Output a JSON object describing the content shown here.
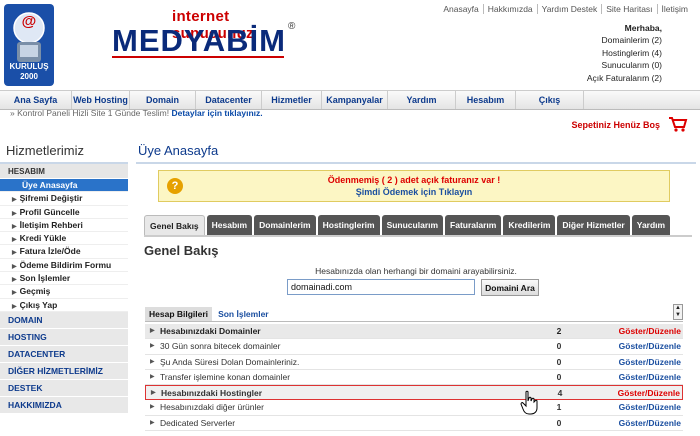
{
  "header": {
    "badge": {
      "label": "KURULUŞ",
      "year": "2000"
    },
    "brand": {
      "tagline": "internet sunucunuz",
      "name": "MEDYABİM",
      "registered": "®"
    },
    "top_links": [
      "Anasayfa",
      "Hakkımızda",
      "Yardım Destek",
      "Site Haritası",
      "İletişim"
    ],
    "welcome": {
      "greeting": "Merhaba,",
      "lines": [
        "Domainlerim (2)",
        "Hostinglerim (4)",
        "Sunucularım (0)",
        "Açık Faturalarım (2)"
      ]
    }
  },
  "nav": [
    "Ana Sayfa",
    "Web Hosting",
    "Domain",
    "Datacenter",
    "Hizmetler",
    "Kampanyalar",
    "Yardım",
    "Hesabım",
    "Çıkış"
  ],
  "ticker": {
    "text": "Kontrol Paneli Hizli Site 1 Günde Teslim!",
    "link": "Detaylar için tıklayınız."
  },
  "cart": {
    "label": "Sepetiniz Henüz Boş"
  },
  "sidebar": {
    "title": "Hizmetlerimiz",
    "section": "HESABIM",
    "items": [
      "Üye Anasayfa",
      "Şifremi Değiştir",
      "Profil Güncelle",
      "İletişim Rehberi",
      "Kredi Yükle",
      "Fatura İzle/Öde",
      "Ödeme Bildirim Formu",
      "Son İşlemler",
      "Geçmiş",
      "Çıkış Yap"
    ],
    "categories": [
      "DOMAIN",
      "HOSTING",
      "DATACENTER",
      "DİĞER HİZMETLERİMİZ",
      "DESTEK",
      "HAKKIMIZDA"
    ]
  },
  "main": {
    "title": "Üye Anasayfa",
    "alert": {
      "line1": "Ödenmemiş ( 2 ) adet açık faturanız var !",
      "line2": "Şimdi Ödemek için Tıklayın"
    },
    "tabs": [
      "Genel Bakış",
      "Hesabım",
      "Domainlerim",
      "Hostinglerim",
      "Sunucularım",
      "Faturalarım",
      "Kredilerim",
      "Diğer Hizmetler",
      "Yardım"
    ],
    "overview_title": "Genel Bakış",
    "search": {
      "label": "Hesabınızda olan herhangi bir domaini arayabilirsiniz.",
      "value": "domainadi.com",
      "button": "Domaini Ara"
    },
    "subtabs": [
      "Hesap Bilgileri",
      "Son İşlemler"
    ],
    "rows": [
      {
        "name": "Hesabınızdaki Domainler",
        "count": "2",
        "action": "Göster/Düzenle"
      },
      {
        "name": "30 Gün sonra bitecek domainler",
        "count": "0",
        "action": "Göster/Düzenle"
      },
      {
        "name": "Şu Anda Süresi Dolan Domainleriniz.",
        "count": "0",
        "action": "Göster/Düzenle"
      },
      {
        "name": "Transfer işlemine konan domainler",
        "count": "0",
        "action": "Göster/Düzenle"
      },
      {
        "name": "Hesabınızdaki Hostingler",
        "count": "4",
        "action": "Göster/Düzenle"
      },
      {
        "name": "Hesabınızdaki diğer ürünler",
        "count": "1",
        "action": "Göster/Düzenle"
      },
      {
        "name": "Dedicated Serverler",
        "count": "0",
        "action": "Göster/Düzenle"
      }
    ]
  }
}
